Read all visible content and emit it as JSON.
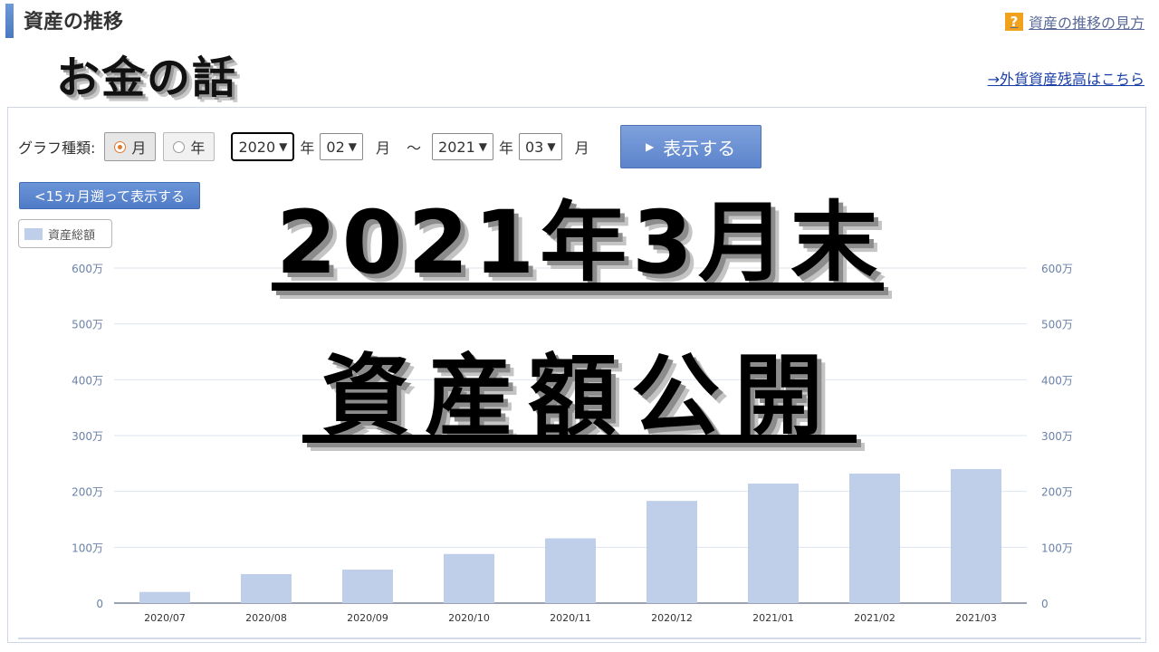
{
  "header": {
    "title": "資産の推移",
    "help_link": "資産の推移の見方",
    "help_icon": "?",
    "fx_link": "→外貨資産残高はこちら"
  },
  "overlay": {
    "tag": "お金の話",
    "line1": "2021年3月末",
    "line2": "資産額公開"
  },
  "controls": {
    "graph_type_label": "グラフ種類:",
    "radio_month": "月",
    "radio_year": "年",
    "selected_type": "月",
    "from_year": "2020",
    "from_month": "02",
    "to_year": "2021",
    "to_month": "03",
    "unit_year": "年",
    "unit_month": "月",
    "tilde": "～",
    "show_button": "表示する",
    "back_button": "<15ヵ月遡って表示する"
  },
  "legend": {
    "label": "資産総額",
    "color": "#bfcfea"
  },
  "chart_data": {
    "type": "bar",
    "categories": [
      "2020/07",
      "2020/08",
      "2020/09",
      "2020/10",
      "2020/11",
      "2020/12",
      "2021/01",
      "2021/02",
      "2021/03"
    ],
    "series": [
      {
        "name": "資産総額",
        "values": [
          20,
          52,
          60,
          88,
          116,
          183,
          214,
          232,
          240
        ]
      }
    ],
    "ylim": [
      0,
      600
    ],
    "y_ticks": [
      0,
      100,
      200,
      300,
      400,
      500,
      600
    ],
    "y_tick_labels": [
      "0",
      "100万",
      "200万",
      "300万",
      "400万",
      "500万",
      "600万"
    ],
    "y_unit": "万円",
    "grid": true,
    "legend_position": "top-left",
    "bar_color": "#bfcfea"
  }
}
